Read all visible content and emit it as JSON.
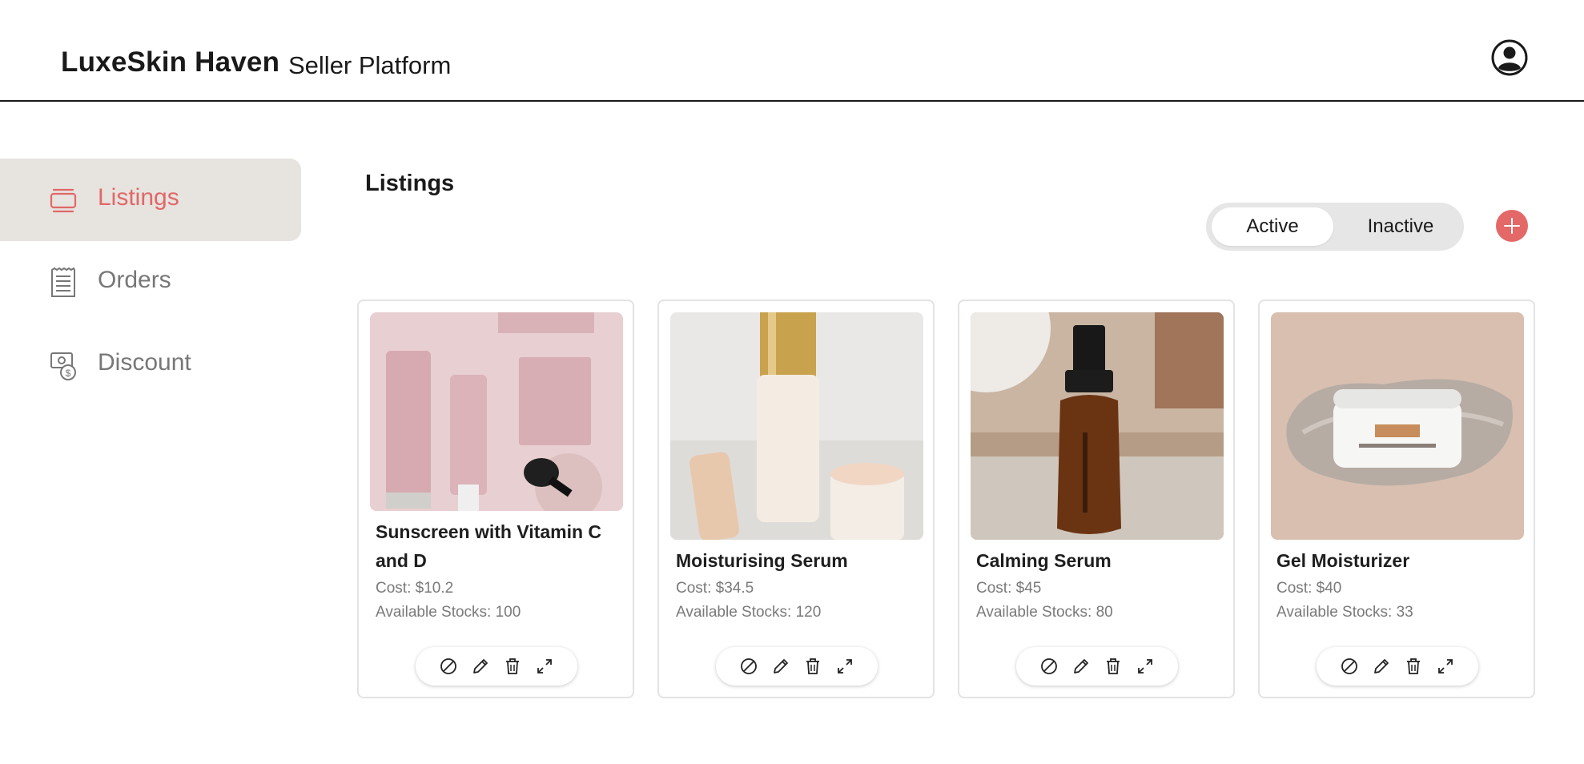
{
  "header": {
    "brand": "LuxeSkin Haven",
    "subtitle": "Seller Platform",
    "account_icon": "user-circle-icon"
  },
  "sidebar": {
    "items": [
      {
        "label": "Listings",
        "icon": "listings-icon",
        "active": true
      },
      {
        "label": "Orders",
        "icon": "orders-icon",
        "active": false
      },
      {
        "label": "Discount",
        "icon": "discount-icon",
        "active": false
      }
    ]
  },
  "main": {
    "title": "Listings",
    "toggle": {
      "active_label": "Active",
      "inactive_label": "Inactive",
      "selected": "Active"
    },
    "add_icon": "plus-icon",
    "products": [
      {
        "name": "Sunscreen with Vitamin C and D",
        "cost": "Cost: $10.2",
        "stock": "Available Stocks: 100"
      },
      {
        "name": "Moisturising Serum",
        "cost": "Cost: $34.5",
        "stock": "Available Stocks: 120"
      },
      {
        "name": "Calming Serum",
        "cost": "Cost: $45",
        "stock": "Available Stocks: 80"
      },
      {
        "name": "Gel Moisturizer",
        "cost": "Cost: $40",
        "stock": "Available Stocks: 33"
      }
    ],
    "card_actions": [
      "deactivate-icon",
      "edit-icon",
      "delete-icon",
      "expand-icon"
    ]
  },
  "colors": {
    "accent": "#e46868",
    "active_nav_bg": "#e7e3df",
    "muted_text": "#777777"
  }
}
